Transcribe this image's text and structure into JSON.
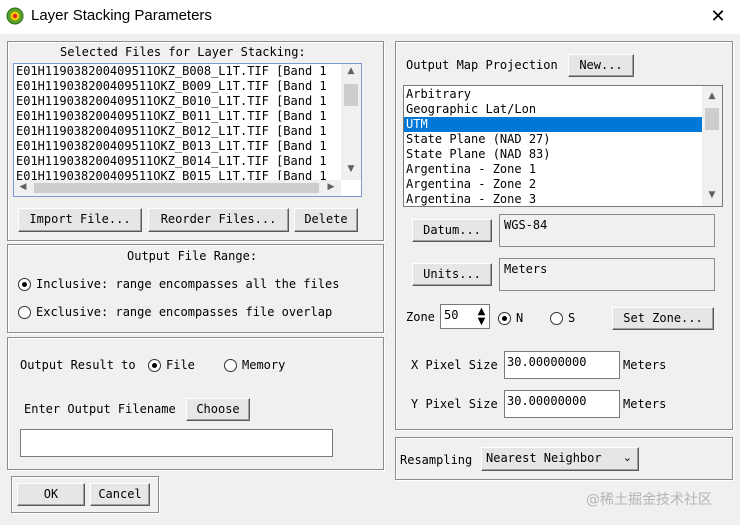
{
  "window": {
    "title": "Layer Stacking Parameters"
  },
  "files": {
    "label": "Selected Files for Layer Stacking:",
    "items": [
      "E01H119038200409511OKZ_B008_L1T.TIF [Band 1",
      "E01H119038200409511OKZ_B009_L1T.TIF [Band 1",
      "E01H119038200409511OKZ_B010_L1T.TIF [Band 1",
      "E01H119038200409511OKZ_B011_L1T.TIF [Band 1",
      "E01H119038200409511OKZ_B012_L1T.TIF [Band 1",
      "E01H119038200409511OKZ_B013_L1T.TIF [Band 1",
      "E01H119038200409511OKZ_B014_L1T.TIF [Band 1",
      "E01H119038200409511OKZ_B015_L1T.TIF [Band 1"
    ],
    "import_label": "Import File...",
    "reorder_label": "Reorder Files...",
    "delete_label": "Delete"
  },
  "range": {
    "label": "Output File Range:",
    "inclusive_label": "Inclusive: range encompasses all the files",
    "exclusive_label": "Exclusive: range encompasses file overlap",
    "selected": "inclusive"
  },
  "output": {
    "label": "Output Result to",
    "file_label": "File",
    "memory_label": "Memory",
    "selected": "file",
    "filename_label": "Enter Output Filename",
    "choose_label": "Choose",
    "filename_value": ""
  },
  "actions": {
    "ok_label": "OK",
    "cancel_label": "Cancel"
  },
  "projection": {
    "label": "Output Map Projection",
    "new_label": "New...",
    "items": [
      "Arbitrary",
      "Geographic Lat/Lon",
      "UTM",
      "State Plane (NAD 27)",
      "State Plane (NAD 83)",
      "Argentina - Zone 1",
      "Argentina - Zone 2",
      "Argentina - Zone 3"
    ],
    "selected": "UTM",
    "datum_label": "Datum...",
    "datum_value": "WGS-84",
    "units_label": "Units...",
    "units_value": "Meters",
    "zone_label": "Zone",
    "zone_value": "50",
    "hemisphere_n": "N",
    "hemisphere_s": "S",
    "hemisphere_selected": "N",
    "set_zone_label": "Set Zone...",
    "x_pixel_label": "X Pixel Size",
    "x_pixel_value": "30.00000000",
    "x_pixel_units": "Meters",
    "y_pixel_label": "Y Pixel Size",
    "y_pixel_value": "30.00000000",
    "y_pixel_units": "Meters"
  },
  "resampling": {
    "label": "Resampling",
    "value": "Nearest Neighbor"
  },
  "watermark": "@稀土掘金技术社区",
  "colors": {
    "selection": "#0078d7",
    "window": "#f0f0f0"
  }
}
